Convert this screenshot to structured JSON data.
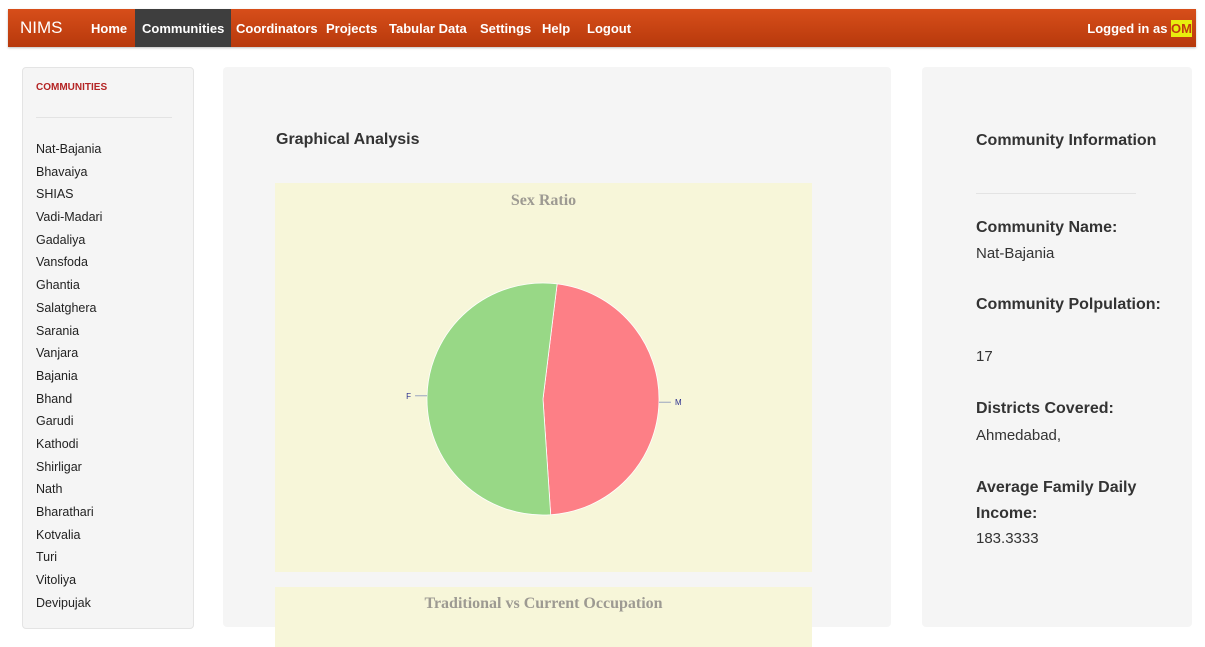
{
  "navbar": {
    "brand": "NIMS",
    "items": [
      "Home",
      "Communities",
      "Coordinators",
      "Projects",
      "Tabular Data",
      "Settings",
      "Help",
      "Logout"
    ],
    "logged_in_prefix": "Logged in as",
    "user": "OM"
  },
  "sidebar": {
    "heading": "COMMUNITIES",
    "items": [
      "Nat-Bajania",
      "Bhavaiya",
      "SHIAS",
      "Vadi-Madari",
      "Gadaliya",
      "Vansfoda",
      "Ghantia",
      "Salatghera",
      "Sarania",
      "Vanjara",
      "Bajania",
      "Bhand",
      "Garudi",
      "Kathodi",
      "Shirligar",
      "Nath",
      "Bharathari",
      "Kotvalia",
      "Turi",
      "Vitoliya",
      "Devipujak"
    ]
  },
  "main": {
    "title": "Graphical Analysis",
    "second_chart_title": "Traditional vs Current Occupation"
  },
  "chart_data": {
    "type": "pie",
    "title": "Sex Ratio",
    "labels": [
      "M",
      "F"
    ],
    "values": [
      47,
      53
    ],
    "colors": [
      "#fd7f86",
      "#98d886"
    ]
  },
  "info": {
    "title": "Community Information",
    "name_label": "Community Name:",
    "name_value": "Nat-Bajania",
    "population_label": "Community Polpulation:",
    "population_value": "17",
    "districts_label": "Districts Covered:",
    "districts_value": "Ahmedabad,",
    "income_label": "Average Family Daily Income:",
    "income_value": "183.3333"
  }
}
